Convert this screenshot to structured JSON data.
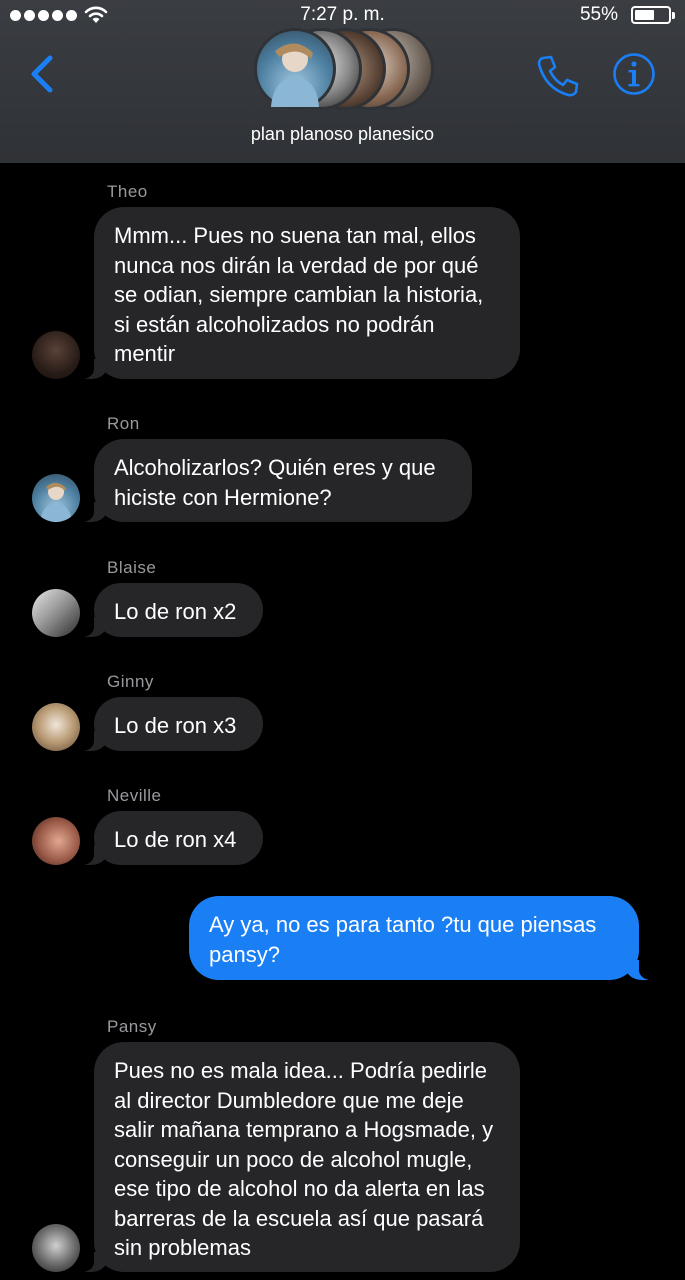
{
  "status_bar": {
    "time": "7:27 p. m.",
    "battery": "55%",
    "battery_level": 0.55,
    "icons": [
      "signal-dots-icon",
      "wifi-icon",
      "battery-icon"
    ]
  },
  "header": {
    "group_name": "plan planoso planesico",
    "icons": [
      "chevron-left-icon",
      "phone-icon",
      "info-icon"
    ],
    "accent": "#1a7ff5"
  },
  "messages": [
    {
      "sender": "Theo",
      "text": "Mmm... Pues no suena tan mal, ellos nunca nos dirán la verdad de por qué se odian, siempre cambian la historia, si están alcoholizados no podrán mentir"
    },
    {
      "sender": "Ron",
      "text": "Alcoholizarlos? Quién eres y que hiciste con Hermione?"
    },
    {
      "sender": "Blaise",
      "text": "Lo de ron x2"
    },
    {
      "sender": "Ginny",
      "text": "Lo de ron x3"
    },
    {
      "sender": "Neville",
      "text": "Lo de ron x4"
    },
    {
      "sender": "",
      "text": "Ay ya, no es para tanto ?tu que piensas pansy?"
    },
    {
      "sender": "Pansy",
      "text": "Pues no es mala idea... Podría pedirle al director Dumbledore que me deje salir mañana temprano a Hogsmade, y conseguir un poco de alcohol mugle, ese tipo de alcohol no da alerta en las barreras de la escuela así que pasará sin problemas"
    }
  ],
  "colors": {
    "incoming_bubble": "#262629",
    "outgoing_bubble": "#1a7ff5",
    "sender_label": "#9a9a9e",
    "header_bg": "#33363a"
  }
}
